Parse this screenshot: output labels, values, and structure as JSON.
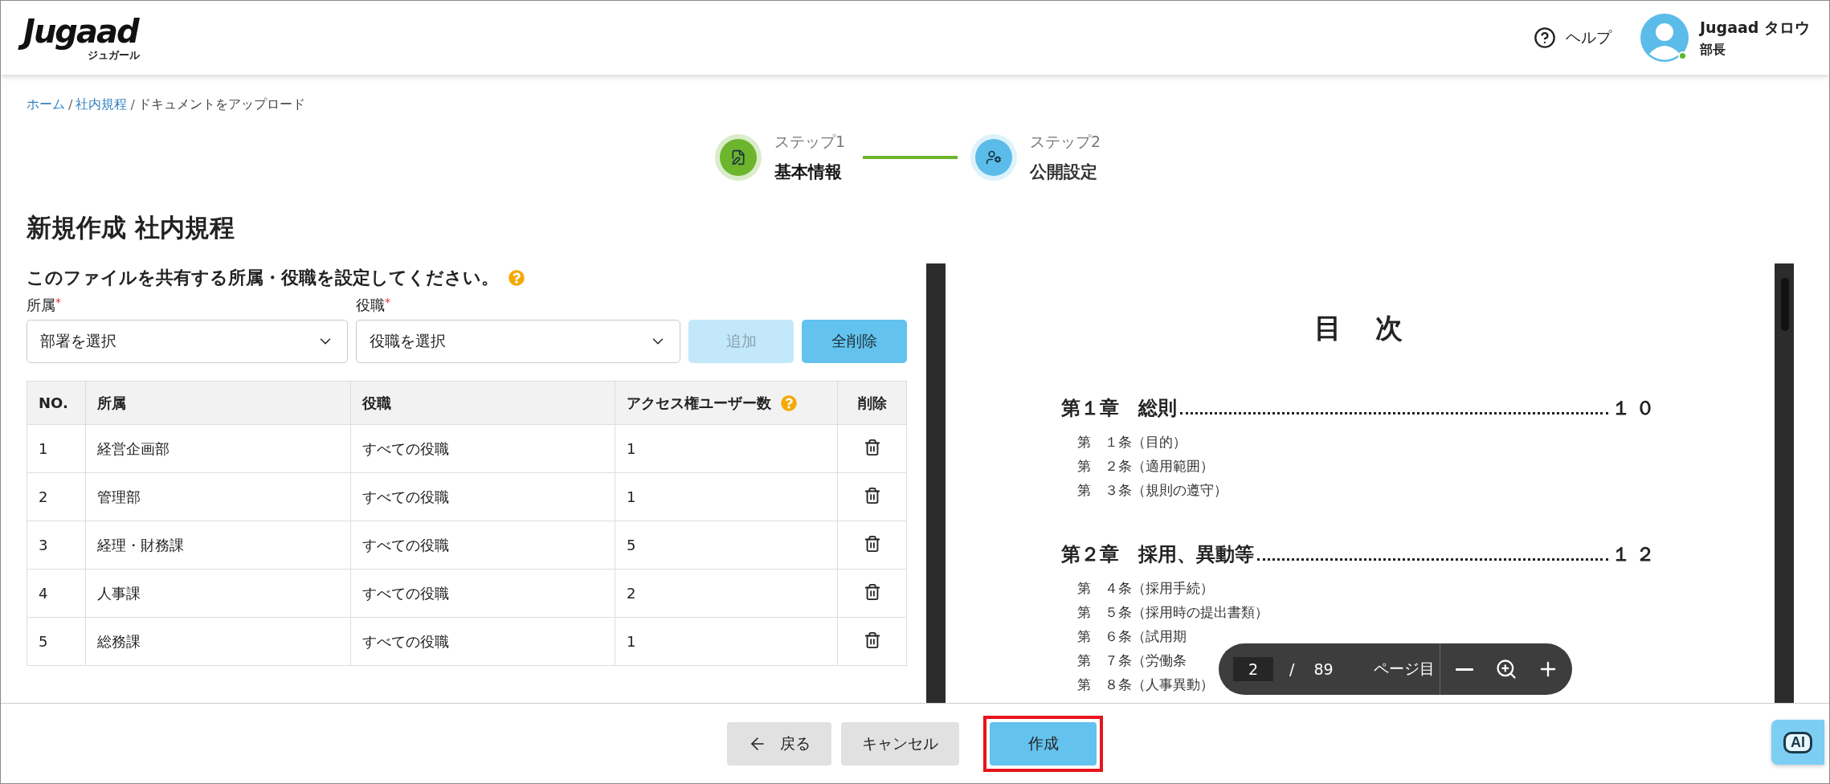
{
  "header": {
    "logo": "Jugaad",
    "logo_sub": "ジュガール",
    "help": "ヘルプ",
    "user": {
      "name": "Jugaad タロウ",
      "role": "部長",
      "online": true
    }
  },
  "breadcrumb": [
    {
      "label": "ホーム",
      "link": true
    },
    {
      "separator": "/",
      "label": "社内規程",
      "link": true
    },
    {
      "separator": "/",
      "label": "ドキュメントをアップロード",
      "link": false
    }
  ],
  "steps": [
    {
      "label": "ステップ1",
      "title": "基本情報",
      "selected": true,
      "color": "#6cb52d",
      "kind": "document"
    },
    {
      "label": "ステップ2",
      "title": "公開設定",
      "selected": false,
      "color": "#5bbce9",
      "kind": "users"
    }
  ],
  "page_title": "新規作成 社内規程",
  "form": {
    "prompt": "このファイルを共有する所属・役職を設定してください。",
    "fields": [
      {
        "label": "所属",
        "required_mark": "*",
        "placeholder": "部署を選択"
      },
      {
        "label": "役職",
        "required_mark": "*",
        "placeholder": "役職を選択"
      }
    ],
    "buttons": [
      {
        "label": "追加",
        "disabled": true
      },
      {
        "label": "全削除",
        "disabled": false
      }
    ]
  },
  "table": {
    "columns": [
      {
        "label": "NO.",
        "help": false
      },
      {
        "label": "所属",
        "help": false
      },
      {
        "label": "役職",
        "help": false
      },
      {
        "label": "アクセス権ユーザー数",
        "help": true
      },
      {
        "label": "削除",
        "help": false
      }
    ],
    "rows": [
      {
        "no": "1",
        "dept": "経営企画部",
        "role": "すべての役職",
        "users": "1"
      },
      {
        "no": "2",
        "dept": "管理部",
        "role": "すべての役職",
        "users": "1"
      },
      {
        "no": "3",
        "dept": "経理・財務課",
        "role": "すべての役職",
        "users": "5"
      },
      {
        "no": "4",
        "dept": "人事課",
        "role": "すべての役職",
        "users": "2"
      },
      {
        "no": "5",
        "dept": "総務課",
        "role": "すべての役職",
        "users": "1"
      }
    ]
  },
  "viewer": {
    "heading": "目　次",
    "sections": [
      {
        "chapter": "第１章　総則",
        "page": "１０",
        "articles": [
          "第　１条（目的）",
          "第　２条（適用範囲）",
          "第　３条（規則の遵守）"
        ]
      },
      {
        "chapter": "第２章　採用、異動等",
        "page": "１２",
        "articles": [
          "第　４条（採用手続）",
          "第　５条（採用時の提出書類）",
          "第　６条（試用期",
          "第　７条（労働条",
          "第　８条（人事異動）"
        ]
      }
    ],
    "toolbar": {
      "page": "2",
      "separator": "/",
      "total": "89",
      "unit": "ページ目"
    }
  },
  "footer": {
    "buttons": [
      {
        "label": "戻る",
        "kind": "back",
        "highlighted": false
      },
      {
        "label": "キャンセル",
        "kind": "secondary",
        "highlighted": false
      },
      {
        "label": "作成",
        "kind": "primary",
        "highlighted": true
      }
    ],
    "ai": "AI"
  }
}
